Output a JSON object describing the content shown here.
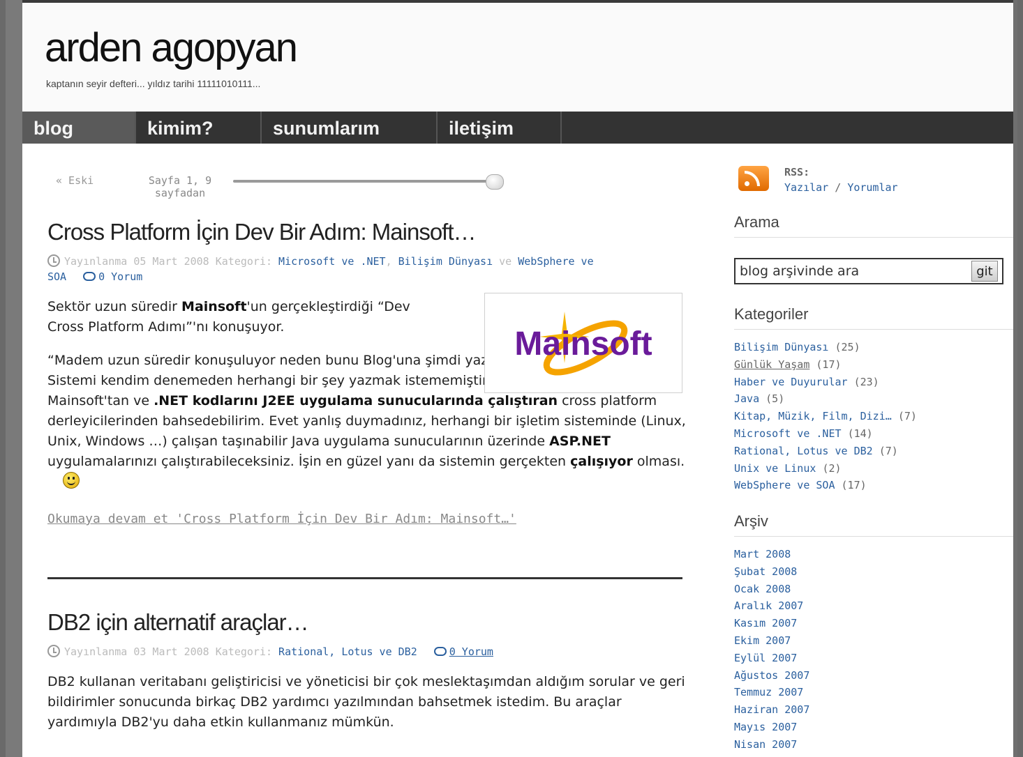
{
  "site": {
    "title": "arden agopyan",
    "tagline": "kaptanın seyir defteri... yıldız tarihi 11111010111..."
  },
  "nav": [
    "blog",
    "kimim?",
    "sunumlarım",
    "iletişim"
  ],
  "pager": {
    "older": "« Eski",
    "page_info": "Sayfa 1, 9 sayfadan"
  },
  "posts": [
    {
      "title": "Cross Platform İçin Dev Bir Adım: Mainsoft…",
      "meta_prefix": "Yayınlanma 05 Mart 2008 Kategori:",
      "categories": [
        "Microsoft ve .NET",
        "Bilişim Dünyası",
        "WebSphere ve SOA"
      ],
      "and_word": "ve",
      "comments": "0 Yorum",
      "logo_text": "Mainsoft",
      "body": {
        "p1_a": "Sektör uzun süredir ",
        "p1_b": "Mainsoft",
        "p1_c": "'un gerçekleştirdiği “Dev Cross Platform Adımı”'nı konuşuyor.",
        "p2_a": "“Madem uzun süredir konuşuluyor neden bunu Blog'una şimdi yazıyorsun?” diyebilirsiniz. Sistemi kendim denemeden herhangi bir şey yazmak istememiştim. Ama bugün itibariyle artık Mainsoft'tan ve ",
        "p2_b": ".NET kodlarını J2EE uygulama sunucularında çalıştıran",
        "p2_c": " cross platform derleyicilerinden bahsedebilirim. Evet yanlış duymadınız, herhangi bir işletim sisteminde (Linux, Unix, Windows …) çalışan taşınabilir Java uygulama sunucularının üzerinde ",
        "p2_d": "ASP.NET",
        "p2_e": " uygulamalarınızı çalıştırabileceksiniz. İşin en güzel yanı da sistemin gerçekten ",
        "p2_f": "çalışıyor",
        "p2_g": " olması."
      },
      "read_more": "Okumaya devam et 'Cross Platform İçin Dev Bir Adım: Mainsoft…'"
    },
    {
      "title": "DB2 için alternatif araçlar…",
      "meta_prefix": "Yayınlanma 03 Mart 2008 Kategori:",
      "categories": [
        "Rational, Lotus ve DB2"
      ],
      "comments": "0 Yorum",
      "body": "DB2 kullanan veritabanı geliştiricisi ve yöneticisi bir çok meslektaşımdan aldığım sorular ve geri bildirimler sonucunda birkaç DB2 yardımcı yazılmından bahsetmek istedim. Bu araçlar yardımıyla DB2'yu daha etkin kullanmanız mümkün."
    }
  ],
  "sidebar": {
    "rss_title": "RSS:",
    "rss_posts": "Yazılar",
    "rss_sep": "/",
    "rss_comments": "Yorumlar",
    "search_title": "Arama",
    "search_placeholder": "blog arşivinde ara",
    "search_button": "git",
    "categories_title": "Kategoriler",
    "categories": [
      {
        "name": "Bilişim Dünyası",
        "count": "(25)"
      },
      {
        "name": "Günlük Yaşam",
        "count": "(17)"
      },
      {
        "name": "Haber ve Duyurular",
        "count": "(23)"
      },
      {
        "name": "Java",
        "count": "(5)"
      },
      {
        "name": "Kitap, Müzik, Film, Dizi…",
        "count": "(7)"
      },
      {
        "name": "Microsoft ve .NET",
        "count": "(14)"
      },
      {
        "name": "Rational, Lotus ve DB2",
        "count": "(7)"
      },
      {
        "name": "Unix ve Linux",
        "count": "(2)"
      },
      {
        "name": "WebSphere ve SOA",
        "count": "(17)"
      }
    ],
    "archive_title": "Arşiv",
    "archive": [
      "Mart 2008",
      "Şubat 2008",
      "Ocak 2008",
      "Aralık 2007",
      "Kasım 2007",
      "Ekim 2007",
      "Eylül 2007",
      "Ağustos 2007",
      "Temmuz 2007",
      "Haziran 2007",
      "Mayıs 2007",
      "Nisan 2007"
    ]
  },
  "colors": {
    "link": "#2a5f9e",
    "nav_bg": "#333333",
    "logo_purple": "#6a1b9a",
    "logo_orange": "#f5a300"
  }
}
